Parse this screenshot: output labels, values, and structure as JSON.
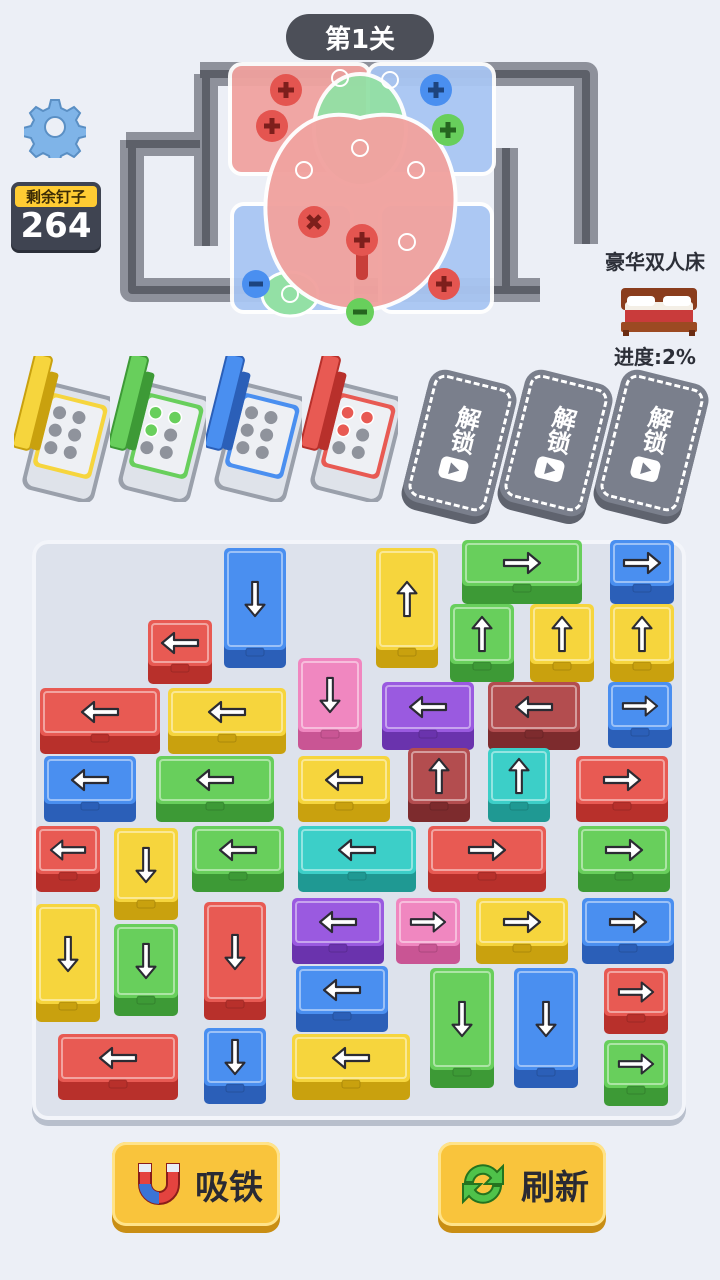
{
  "header": {
    "level": "第1关"
  },
  "remaining": {
    "label": "剩余钉子",
    "count": "264"
  },
  "reward": {
    "name": "豪华双人床",
    "progress": "进度:2%"
  },
  "locked_slot_label": "解锁",
  "buttons": {
    "magnet": "吸铁",
    "refresh": "刷新"
  },
  "colors": {
    "red": [
      "#e85a53",
      "#b8302b"
    ],
    "blue": [
      "#4a8ff0",
      "#2b5fb8"
    ],
    "yellow": [
      "#f6d53d",
      "#c9a10e"
    ],
    "green": [
      "#68cf5c",
      "#3d9a36"
    ],
    "pink": [
      "#f087c0",
      "#c95594"
    ],
    "purple": [
      "#9a5ae0",
      "#6a33ad"
    ],
    "maroon": [
      "#b34d4f",
      "#7d2b2d"
    ],
    "teal": [
      "#3ccfc8",
      "#1f9993"
    ]
  },
  "trays": [
    {
      "color": "yellow",
      "filled": 0
    },
    {
      "color": "green",
      "filled": 3
    },
    {
      "color": "blue",
      "filled": 0
    },
    {
      "color": "red",
      "filled": 3
    }
  ],
  "boxes": [
    [
      "blue",
      "down"
    ],
    [
      "yellow",
      "up"
    ],
    [
      "green",
      "right"
    ],
    [
      "blue",
      "right"
    ],
    [
      "red",
      "left"
    ],
    [
      "green",
      "up"
    ],
    [
      "yellow",
      "up"
    ],
    [
      "yellow",
      "up"
    ],
    [
      "red",
      "left"
    ],
    [
      "yellow",
      "left"
    ],
    [
      "pink",
      "down"
    ],
    [
      "purple",
      "left"
    ],
    [
      "maroon",
      "left"
    ],
    [
      "blue",
      "right"
    ],
    [
      "blue",
      "left"
    ],
    [
      "green",
      "left"
    ],
    [
      "yellow",
      "left"
    ],
    [
      "maroon",
      "up"
    ],
    [
      "teal",
      "up"
    ],
    [
      "red",
      "right"
    ],
    [
      "red",
      "left"
    ],
    [
      "yellow",
      "down"
    ],
    [
      "green",
      "left"
    ],
    [
      "teal",
      "left"
    ],
    [
      "red",
      "right"
    ],
    [
      "green",
      "right"
    ],
    [
      "yellow",
      "down"
    ],
    [
      "green",
      "down"
    ],
    [
      "red",
      "down"
    ],
    [
      "purple",
      "left"
    ],
    [
      "pink",
      "right"
    ],
    [
      "yellow",
      "right"
    ],
    [
      "blue",
      "right"
    ],
    [
      "blue",
      "left"
    ],
    [
      "green",
      "down"
    ],
    [
      "blue",
      "down"
    ],
    [
      "red",
      "right"
    ],
    [
      "red",
      "left"
    ],
    [
      "blue",
      "down"
    ],
    [
      "yellow",
      "left"
    ],
    [
      "green",
      "right"
    ]
  ]
}
